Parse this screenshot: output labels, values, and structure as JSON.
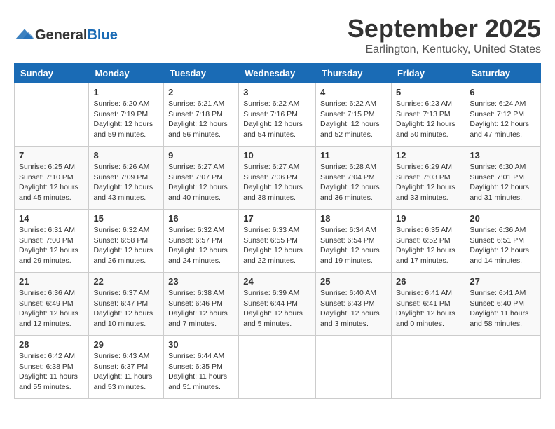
{
  "header": {
    "logo_general": "General",
    "logo_blue": "Blue",
    "month_title": "September 2025",
    "location": "Earlington, Kentucky, United States"
  },
  "calendar": {
    "days_of_week": [
      "Sunday",
      "Monday",
      "Tuesday",
      "Wednesday",
      "Thursday",
      "Friday",
      "Saturday"
    ],
    "weeks": [
      [
        {
          "day": "",
          "info": ""
        },
        {
          "day": "1",
          "info": "Sunrise: 6:20 AM\nSunset: 7:19 PM\nDaylight: 12 hours\nand 59 minutes."
        },
        {
          "day": "2",
          "info": "Sunrise: 6:21 AM\nSunset: 7:18 PM\nDaylight: 12 hours\nand 56 minutes."
        },
        {
          "day": "3",
          "info": "Sunrise: 6:22 AM\nSunset: 7:16 PM\nDaylight: 12 hours\nand 54 minutes."
        },
        {
          "day": "4",
          "info": "Sunrise: 6:22 AM\nSunset: 7:15 PM\nDaylight: 12 hours\nand 52 minutes."
        },
        {
          "day": "5",
          "info": "Sunrise: 6:23 AM\nSunset: 7:13 PM\nDaylight: 12 hours\nand 50 minutes."
        },
        {
          "day": "6",
          "info": "Sunrise: 6:24 AM\nSunset: 7:12 PM\nDaylight: 12 hours\nand 47 minutes."
        }
      ],
      [
        {
          "day": "7",
          "info": "Sunrise: 6:25 AM\nSunset: 7:10 PM\nDaylight: 12 hours\nand 45 minutes."
        },
        {
          "day": "8",
          "info": "Sunrise: 6:26 AM\nSunset: 7:09 PM\nDaylight: 12 hours\nand 43 minutes."
        },
        {
          "day": "9",
          "info": "Sunrise: 6:27 AM\nSunset: 7:07 PM\nDaylight: 12 hours\nand 40 minutes."
        },
        {
          "day": "10",
          "info": "Sunrise: 6:27 AM\nSunset: 7:06 PM\nDaylight: 12 hours\nand 38 minutes."
        },
        {
          "day": "11",
          "info": "Sunrise: 6:28 AM\nSunset: 7:04 PM\nDaylight: 12 hours\nand 36 minutes."
        },
        {
          "day": "12",
          "info": "Sunrise: 6:29 AM\nSunset: 7:03 PM\nDaylight: 12 hours\nand 33 minutes."
        },
        {
          "day": "13",
          "info": "Sunrise: 6:30 AM\nSunset: 7:01 PM\nDaylight: 12 hours\nand 31 minutes."
        }
      ],
      [
        {
          "day": "14",
          "info": "Sunrise: 6:31 AM\nSunset: 7:00 PM\nDaylight: 12 hours\nand 29 minutes."
        },
        {
          "day": "15",
          "info": "Sunrise: 6:32 AM\nSunset: 6:58 PM\nDaylight: 12 hours\nand 26 minutes."
        },
        {
          "day": "16",
          "info": "Sunrise: 6:32 AM\nSunset: 6:57 PM\nDaylight: 12 hours\nand 24 minutes."
        },
        {
          "day": "17",
          "info": "Sunrise: 6:33 AM\nSunset: 6:55 PM\nDaylight: 12 hours\nand 22 minutes."
        },
        {
          "day": "18",
          "info": "Sunrise: 6:34 AM\nSunset: 6:54 PM\nDaylight: 12 hours\nand 19 minutes."
        },
        {
          "day": "19",
          "info": "Sunrise: 6:35 AM\nSunset: 6:52 PM\nDaylight: 12 hours\nand 17 minutes."
        },
        {
          "day": "20",
          "info": "Sunrise: 6:36 AM\nSunset: 6:51 PM\nDaylight: 12 hours\nand 14 minutes."
        }
      ],
      [
        {
          "day": "21",
          "info": "Sunrise: 6:36 AM\nSunset: 6:49 PM\nDaylight: 12 hours\nand 12 minutes."
        },
        {
          "day": "22",
          "info": "Sunrise: 6:37 AM\nSunset: 6:47 PM\nDaylight: 12 hours\nand 10 minutes."
        },
        {
          "day": "23",
          "info": "Sunrise: 6:38 AM\nSunset: 6:46 PM\nDaylight: 12 hours\nand 7 minutes."
        },
        {
          "day": "24",
          "info": "Sunrise: 6:39 AM\nSunset: 6:44 PM\nDaylight: 12 hours\nand 5 minutes."
        },
        {
          "day": "25",
          "info": "Sunrise: 6:40 AM\nSunset: 6:43 PM\nDaylight: 12 hours\nand 3 minutes."
        },
        {
          "day": "26",
          "info": "Sunrise: 6:41 AM\nSunset: 6:41 PM\nDaylight: 12 hours\nand 0 minutes."
        },
        {
          "day": "27",
          "info": "Sunrise: 6:41 AM\nSunset: 6:40 PM\nDaylight: 11 hours\nand 58 minutes."
        }
      ],
      [
        {
          "day": "28",
          "info": "Sunrise: 6:42 AM\nSunset: 6:38 PM\nDaylight: 11 hours\nand 55 minutes."
        },
        {
          "day": "29",
          "info": "Sunrise: 6:43 AM\nSunset: 6:37 PM\nDaylight: 11 hours\nand 53 minutes."
        },
        {
          "day": "30",
          "info": "Sunrise: 6:44 AM\nSunset: 6:35 PM\nDaylight: 11 hours\nand 51 minutes."
        },
        {
          "day": "",
          "info": ""
        },
        {
          "day": "",
          "info": ""
        },
        {
          "day": "",
          "info": ""
        },
        {
          "day": "",
          "info": ""
        }
      ]
    ]
  }
}
